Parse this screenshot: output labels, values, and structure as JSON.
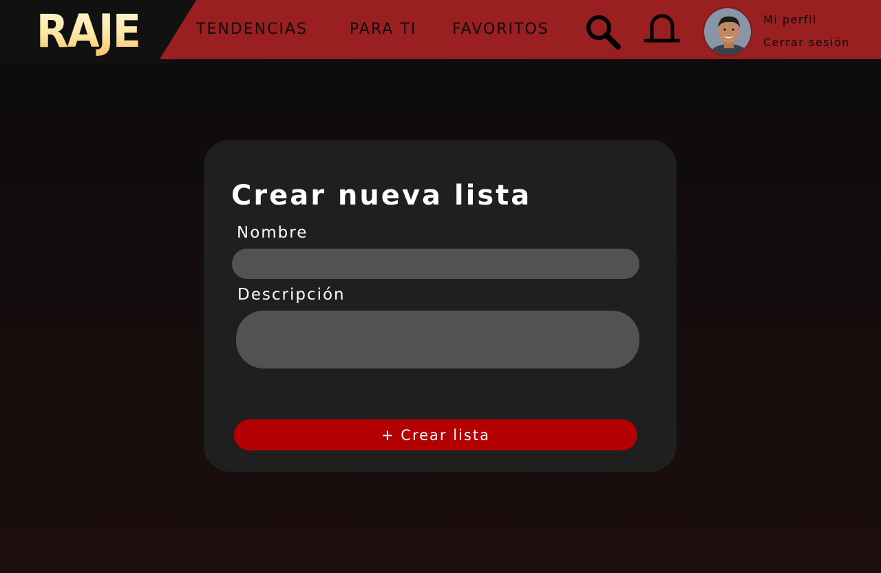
{
  "brand": {
    "logo_text": "RAJE"
  },
  "nav": {
    "items": [
      {
        "label": "TENDENCIAS"
      },
      {
        "label": "PARA TI"
      },
      {
        "label": "FAVORITOS"
      }
    ]
  },
  "header": {
    "icons": [
      "search-icon",
      "bell-icon"
    ],
    "profile_label": "Mi perfil",
    "logout_label": "Cerrar sesión"
  },
  "form": {
    "title": "Crear nueva lista",
    "name_label": "Nombre",
    "name_value": "",
    "description_label": "Descripción",
    "description_value": "",
    "submit_label": "+ Crear lista"
  },
  "colors": {
    "header_bg": "#9a1f21",
    "logo_bg": "#111111",
    "card_bg": "#1f1f1f",
    "input_bg": "#525252",
    "accent": "#b30000"
  }
}
